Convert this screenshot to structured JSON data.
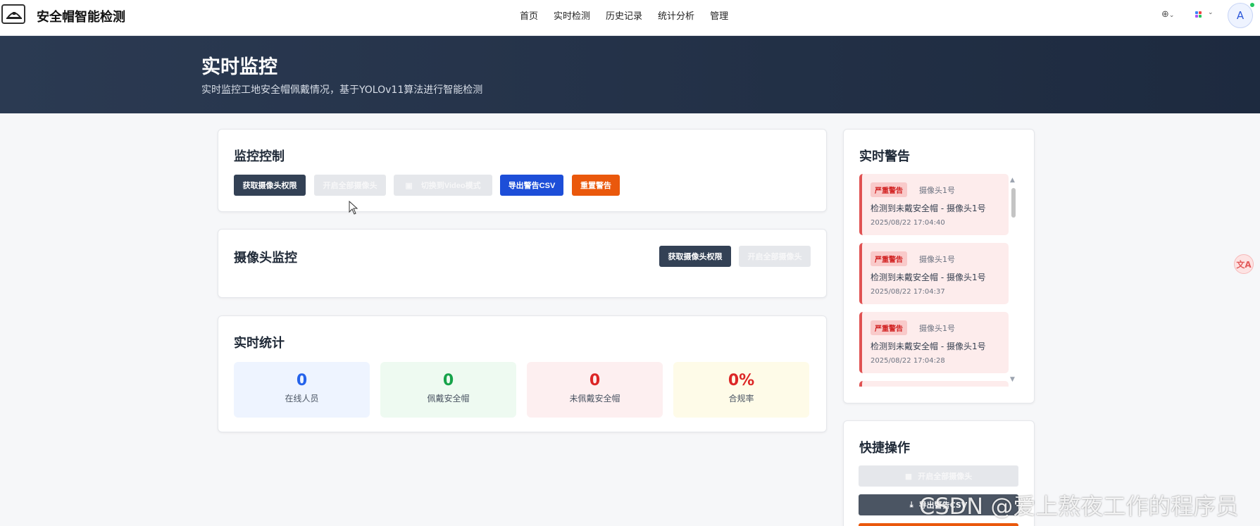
{
  "app": {
    "title": "安全帽智能检测"
  },
  "nav": {
    "items": [
      "首页",
      "实时检测",
      "历史记录",
      "统计分析",
      "管理"
    ]
  },
  "user": {
    "avatar_initial": "A"
  },
  "hero": {
    "title": "实时监控",
    "subtitle": "实时监控工地安全帽佩戴情况，基于YOLOv11算法进行智能检测"
  },
  "control": {
    "title": "监控控制",
    "buttons": {
      "camera_permission": "获取摄像头权限",
      "open_all": "开启全部摄像头",
      "switch_video": "切换到Video模式",
      "export_csv": "导出警告CSV",
      "reset_alerts": "重置警告"
    }
  },
  "camera": {
    "title": "摄像头监控",
    "buttons": {
      "camera_permission": "获取摄像头权限",
      "open_all": "开启全部摄像头"
    }
  },
  "stats": {
    "title": "实时统计",
    "items": [
      {
        "value": "0",
        "label": "在线人员",
        "color": "#2563eb",
        "bg": "#eef4ff"
      },
      {
        "value": "0",
        "label": "佩戴安全帽",
        "color": "#16a34a",
        "bg": "#eefaf1"
      },
      {
        "value": "0",
        "label": "未佩戴安全帽",
        "color": "#dc2626",
        "bg": "#fdeff0"
      },
      {
        "value": "0%",
        "label": "合规率",
        "color": "#dc2626",
        "bg": "#fefbe8"
      }
    ]
  },
  "alerts": {
    "title": "实时警告",
    "items": [
      {
        "tag": "严重警告",
        "camera": "摄像头1号",
        "message": "检测到未戴安全帽 - 摄像头1号",
        "time": "2025/08/22 17:04:40"
      },
      {
        "tag": "严重警告",
        "camera": "摄像头1号",
        "message": "检测到未戴安全帽 - 摄像头1号",
        "time": "2025/08/22 17:04:37"
      },
      {
        "tag": "严重警告",
        "camera": "摄像头1号",
        "message": "检测到未戴安全帽 - 摄像头1号",
        "time": "2025/08/22 17:04:28"
      }
    ]
  },
  "quick": {
    "title": "快捷操作",
    "open_all": "开启全部摄像头",
    "export_csv": "导出警告CSV"
  },
  "watermark": "CSDN @爱上熬夜工作的程序员",
  "colors": {
    "accent": "#1d4ed8",
    "danger": "#ea580c",
    "dark": "#334155",
    "hero": "#1d2a3f"
  }
}
